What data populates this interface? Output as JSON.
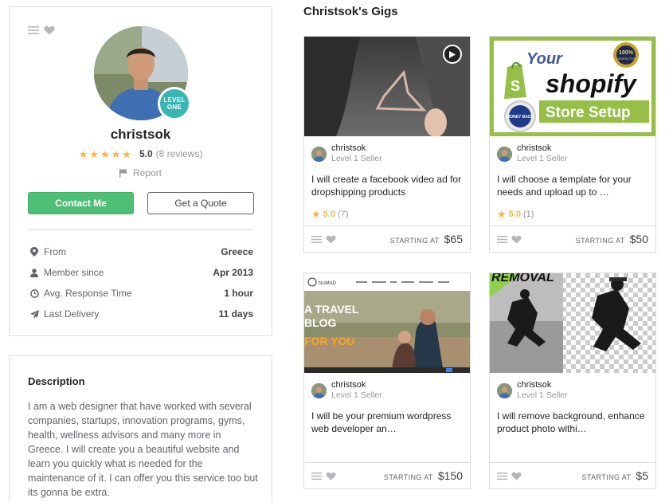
{
  "profile": {
    "username": "christsok",
    "level_badge_line1": "LEVEL",
    "level_badge_line2": "ONE",
    "rating_value": "5.0",
    "rating_count": "(8 reviews)",
    "stars": 5,
    "report_label": "Report",
    "contact_button": "Contact Me",
    "quote_button": "Get a Quote",
    "stats": [
      {
        "icon": "location-pin-icon",
        "label": "From",
        "value": "Greece"
      },
      {
        "icon": "user-icon",
        "label": "Member since",
        "value": "Apr 2013"
      },
      {
        "icon": "clock-icon",
        "label": "Avg. Response Time",
        "value": "1 hour"
      },
      {
        "icon": "paper-plane-icon",
        "label": "Last Delivery",
        "value": "11 days"
      }
    ]
  },
  "description": {
    "title": "Description",
    "text": "I am a web designer that have worked with several companies, startups, innovation programs, gyms, health, wellness advisors and many more in Greece. I will create you a beautiful website and learn you quickly what is needed for the maintenance of it. I can offer you this service too but its gonna be extra."
  },
  "gigs_section": {
    "title": "Christsok's Gigs",
    "starting_at_label": "STARTING AT",
    "gigs": [
      {
        "seller": "christsok",
        "level": "Level 1 Seller",
        "title": "I will create a facebook video ad for dropshipping products",
        "rating": "5.0",
        "rating_count": "(7)",
        "price": "$65",
        "thumb_text": []
      },
      {
        "seller": "christsok",
        "level": "Level 1 Seller",
        "title": "I will choose a template for your needs and upload up to …",
        "rating": "5.0",
        "rating_count": "(1)",
        "price": "$50",
        "thumb_text": [
          "Your",
          "shopify",
          "Store Setup",
          "100%",
          "SATISFACTION",
          "MONEY BACK"
        ]
      },
      {
        "seller": "christsok",
        "level": "Level 1 Seller",
        "title": "I will be your premium wordpress web developer an…",
        "rating": "",
        "rating_count": "",
        "price": "$150",
        "thumb_text": [
          "A TRAVEL",
          "BLOG",
          "FOR YOU",
          "NUMAD"
        ]
      },
      {
        "seller": "christsok",
        "level": "Level 1 Seller",
        "title": "I will remove background, enhance product photo withi…",
        "rating": "",
        "rating_count": "",
        "price": "$5",
        "thumb_text": [
          "REMOVAL"
        ]
      }
    ]
  },
  "colors": {
    "accent_green": "#4fbf76",
    "star_yellow": "#ffb33e",
    "level_badge": "#37b6b4",
    "border": "#dadbdd",
    "shopify_green": "#95bf47"
  }
}
